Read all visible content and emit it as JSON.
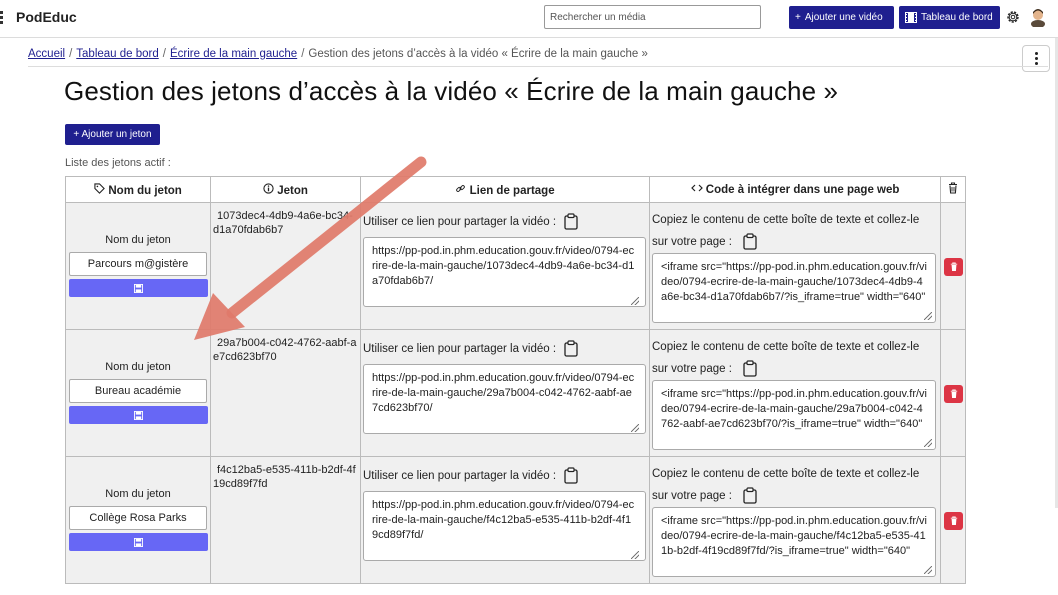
{
  "header": {
    "brand": "PodEduc",
    "search_placeholder": "Rechercher un média",
    "add_video": "Ajouter une vidéo",
    "dashboard": "Tableau de bord"
  },
  "breadcrumb": {
    "home": "Accueil",
    "dashboard": "Tableau de bord",
    "video": "Écrire de la main gauche",
    "current": "Gestion des jetons d’accès à la vidéo « Écrire de la main gauche »"
  },
  "page": {
    "title": "Gestion des jetons d’accès à la vidéo « Écrire de la main gauche »",
    "add_token": "Ajouter un jeton",
    "list_label": "Liste des jetons actif :"
  },
  "table": {
    "headers": {
      "name": "Nom du jeton",
      "token": "Jeton",
      "link": "Lien de partage",
      "code": "Code à intégrer dans une page web"
    },
    "name_label": "Nom du jeton",
    "share_text": "Utiliser ce lien pour partager la vidéo :",
    "code_text": "Copiez le contenu de cette boîte de texte et collez-le sur votre page :",
    "rows": [
      {
        "name": "Parcours m@gistère",
        "token": "1073dec4-4db9-4a6e-bc34-d1a70fdab6b7",
        "link": "https://pp-pod.in.phm.education.gouv.fr/video/0794-ecrire-de-la-main-gauche/1073dec4-4db9-4a6e-bc34-d1a70fdab6b7/",
        "code": "<iframe src=\"https://pp-pod.in.phm.education.gouv.fr/video/0794-ecrire-de-la-main-gauche/1073dec4-4db9-4a6e-bc34-d1a70fdab6b7/?is_iframe=true\" width=\"640\""
      },
      {
        "name": "Bureau académie",
        "token": "29a7b004-c042-4762-aabf-ae7cd623bf70",
        "link": "https://pp-pod.in.phm.education.gouv.fr/video/0794-ecrire-de-la-main-gauche/29a7b004-c042-4762-aabf-ae7cd623bf70/",
        "code": "<iframe src=\"https://pp-pod.in.phm.education.gouv.fr/video/0794-ecrire-de-la-main-gauche/29a7b004-c042-4762-aabf-ae7cd623bf70/?is_iframe=true\" width=\"640\""
      },
      {
        "name": "Collège Rosa Parks",
        "token": "f4c12ba5-e535-411b-b2df-4f19cd89f7fd",
        "link": "https://pp-pod.in.phm.education.gouv.fr/video/0794-ecrire-de-la-main-gauche/f4c12ba5-e535-411b-b2df-4f19cd89f7fd/",
        "code": "<iframe src=\"https://pp-pod.in.phm.education.gouv.fr/video/0794-ecrire-de-la-main-gauche/f4c12ba5-e535-411b-b2df-4f19cd89f7fd/?is_iframe=true\" width=\"640\""
      }
    ]
  },
  "colors": {
    "primary": "#1f1f8f",
    "save": "#6767f5",
    "danger": "#dc3545",
    "arrow": "#e07a6a"
  },
  "icons": [
    "menu-icon",
    "plus-icon",
    "film-icon",
    "gear-icon",
    "avatar-icon",
    "tag-icon",
    "info-icon",
    "link-icon",
    "code-icon",
    "trash-icon",
    "clipboard-icon",
    "save-icon",
    "resize-grip-icon"
  ]
}
